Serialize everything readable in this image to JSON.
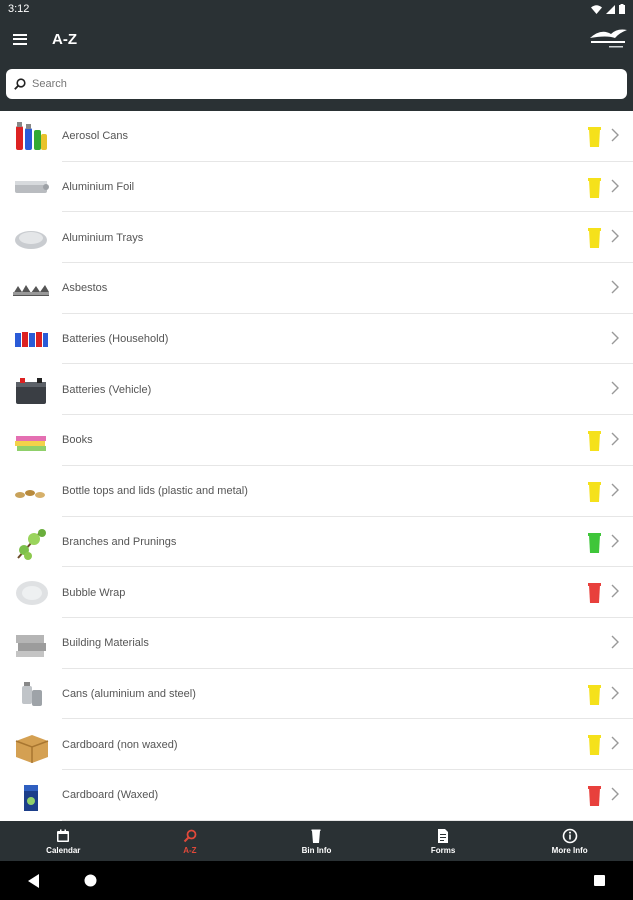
{
  "status": {
    "time": "3:12"
  },
  "appbar": {
    "title": "A-Z"
  },
  "search": {
    "placeholder": "Search"
  },
  "items": [
    {
      "label": "Aerosol Cans",
      "bin": "yellow"
    },
    {
      "label": "Aluminium Foil",
      "bin": "yellow"
    },
    {
      "label": "Aluminium Trays",
      "bin": "yellow"
    },
    {
      "label": "Asbestos",
      "bin": "none"
    },
    {
      "label": "Batteries (Household)",
      "bin": "none"
    },
    {
      "label": "Batteries (Vehicle)",
      "bin": "none"
    },
    {
      "label": "Books",
      "bin": "yellow"
    },
    {
      "label": "Bottle tops and lids (plastic and metal)",
      "bin": "yellow"
    },
    {
      "label": "Branches and Prunings",
      "bin": "green"
    },
    {
      "label": "Bubble Wrap",
      "bin": "red"
    },
    {
      "label": "Building Materials",
      "bin": "none"
    },
    {
      "label": "Cans (aluminium and steel)",
      "bin": "yellow"
    },
    {
      "label": "Cardboard (non waxed)",
      "bin": "yellow"
    },
    {
      "label": "Cardboard (Waxed)",
      "bin": "red"
    }
  ],
  "bin_colors": {
    "yellow": "#f5e11b",
    "green": "#3fc63a",
    "red": "#e8403c"
  },
  "nav": {
    "calendar": "Calendar",
    "az": "A-Z",
    "bininfo": "Bin Info",
    "forms": "Forms",
    "moreinfo": "More Info"
  }
}
